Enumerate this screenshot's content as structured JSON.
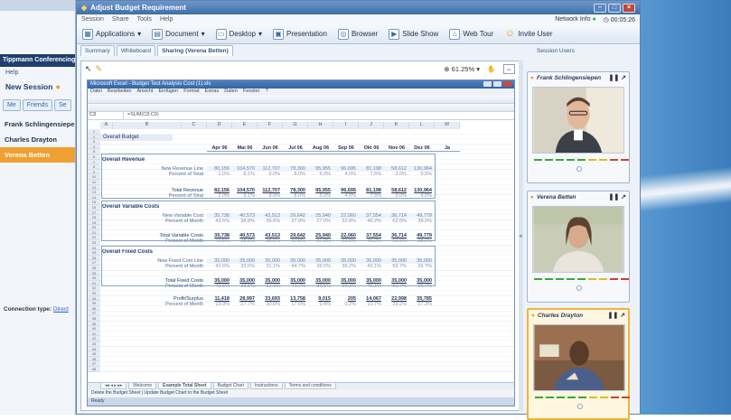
{
  "left_app": {
    "title": "Tippmann Conferencing",
    "help": "Help",
    "new_session": "New Session",
    "tabs": [
      "Me",
      "Friends",
      "Se"
    ],
    "users": [
      {
        "name": "Frank Schlingensiepen",
        "selected": false
      },
      {
        "name": "Charles Drayton",
        "selected": false
      },
      {
        "name": "Verena Betten",
        "selected": true
      }
    ],
    "connection_label": "Connection type:",
    "connection_value": "Direct"
  },
  "window": {
    "title": "Adjust Budget Requirement",
    "menu": [
      "Session",
      "Share",
      "Tools",
      "Help"
    ],
    "network_info": "Network Info",
    "timer": "00:05:26",
    "toolbar": [
      {
        "label": "Applications",
        "icon": "applications-icon",
        "dropdown": true
      },
      {
        "label": "Document",
        "icon": "document-icon",
        "dropdown": true
      },
      {
        "label": "Desktop",
        "icon": "desktop-icon",
        "dropdown": true
      },
      {
        "label": "Presentation",
        "icon": "presentation-icon",
        "dropdown": false
      },
      {
        "label": "Browser",
        "icon": "browser-icon",
        "dropdown": false
      },
      {
        "label": "Slide Show",
        "icon": "slideshow-icon",
        "dropdown": false
      },
      {
        "label": "Web Tour",
        "icon": "webtour-icon",
        "dropdown": false
      },
      {
        "label": "Invite User",
        "icon": "invite-user-icon",
        "dropdown": false
      }
    ],
    "tabs": [
      {
        "label": "Summary",
        "active": false
      },
      {
        "label": "Whiteboard",
        "active": false
      },
      {
        "label": "Sharing (Verena Betten)",
        "active": true
      }
    ],
    "session_users_label": "Session Users",
    "zoom": "61.25%"
  },
  "excel": {
    "title": "Microsoft Excel - Budget Test Analysis Cost (1).xls",
    "menu": [
      "Datei",
      "Bearbeiten",
      "Ansicht",
      "Einfügen",
      "Format",
      "Extras",
      "Daten",
      "Fenster",
      "?"
    ],
    "cell_ref": "C3",
    "formula": "=SUM(C8:C9)",
    "columns": [
      "A",
      "B",
      "C",
      "D",
      "E",
      "F",
      "G",
      "H",
      "I",
      "J",
      "K",
      "L",
      "M"
    ],
    "heading": "Overall Budget",
    "months": [
      "Apr 06",
      "Mai 06",
      "Jun 06",
      "Jul 06",
      "Aug 06",
      "Sep 06",
      "Okt 06",
      "Nov 06",
      "Dez 06",
      "Ja"
    ],
    "rows": [
      {
        "label": "Overall Revenue",
        "kind": "section"
      },
      {
        "label": "New Revenue Line",
        "kind": "input",
        "values": [
          "80,156",
          "104,570",
          "112,707",
          "78,300",
          "95,955",
          "96,695",
          "81,198",
          "58,612",
          "130,964"
        ]
      },
      {
        "label": "Percent of Total",
        "kind": "pct",
        "values": [
          "1.0%",
          "6.1%",
          "9.0%",
          "8.0%",
          "5.0%",
          "4.0%",
          "7.5%",
          "3.0%",
          "9.5%"
        ]
      },
      {
        "label": "Total Revenue",
        "kind": "total",
        "values": [
          "82,156",
          "104,570",
          "112,707",
          "78,300",
          "95,955",
          "96,695",
          "81,198",
          "58,612",
          "130,964"
        ]
      },
      {
        "label": "Percent of Total",
        "kind": "pct",
        "values": [
          "1.0%",
          "6.1%",
          "9.0%",
          "8.0%",
          "5.0%",
          "4.0%",
          "7.5%",
          "3.0%",
          "9.5%"
        ]
      },
      {
        "label": "Overall Variable Costs",
        "kind": "section"
      },
      {
        "label": "New Variable Cost",
        "kind": "input",
        "values": [
          "35,738",
          "40,573",
          "43,513",
          "29,642",
          "25,940",
          "22,060",
          "37,554",
          "36,714",
          "49,779"
        ]
      },
      {
        "label": "Percent of Month",
        "kind": "pct",
        "values": [
          "43.5%",
          "38.8%",
          "38.6%",
          "37.9%",
          "27.0%",
          "22.8%",
          "46.2%",
          "62.6%",
          "38.0%"
        ]
      },
      {
        "label": "Total Variable Costs",
        "kind": "total",
        "values": [
          "35,738",
          "40,573",
          "43,513",
          "29,642",
          "25,940",
          "22,060",
          "37,554",
          "36,714",
          "49,779"
        ]
      },
      {
        "label": "Percent of Month",
        "kind": "pct",
        "values": [
          "43.5%",
          "38.8%",
          "38.6%",
          "37.9%",
          "27.0%",
          "22.8%",
          "46.2%",
          "62.6%",
          "38.0%"
        ]
      },
      {
        "label": "Overall Fixed Costs",
        "kind": "section"
      },
      {
        "label": "New Fixed Cost Line",
        "kind": "input",
        "values": [
          "35,000",
          "35,000",
          "35,000",
          "35,000",
          "35,000",
          "35,000",
          "35,000",
          "35,000",
          "35,000"
        ]
      },
      {
        "label": "Percent of Month",
        "kind": "pct",
        "values": [
          "42.6%",
          "33.5%",
          "31.1%",
          "44.7%",
          "36.5%",
          "36.2%",
          "43.1%",
          "59.7%",
          "26.7%"
        ]
      },
      {
        "label": "Total Fixed Costs",
        "kind": "total",
        "values": [
          "35,000",
          "35,000",
          "35,000",
          "35,000",
          "35,000",
          "35,000",
          "35,000",
          "35,000",
          "35,000"
        ]
      },
      {
        "label": "Percent of Month",
        "kind": "pct",
        "values": [
          "42.6%",
          "33.5%",
          "31.1%",
          "44.7%",
          "36.5%",
          "36.2%",
          "43.1%",
          "59.7%",
          "26.7%"
        ]
      },
      {
        "label": "Profit/Surplus",
        "kind": "total",
        "values": [
          "11,418",
          "28,997",
          "33,693",
          "13,758",
          "9,015",
          "205",
          "14,067",
          "22,998",
          "35,785"
        ]
      },
      {
        "label": "Percent of Month",
        "kind": "pct",
        "values": [
          "13.9%",
          "27.7%",
          "30.0%",
          "17.6%",
          "9.4%",
          "0.2%",
          "10.7%",
          "39.2%",
          "27.3%"
        ]
      }
    ],
    "sheet_tabs": [
      {
        "label": "Welcome",
        "active": false
      },
      {
        "label": "Example Total Sheet",
        "active": true
      },
      {
        "label": "Budget Chart",
        "active": false
      },
      {
        "label": "Instructions",
        "active": false
      },
      {
        "label": "Terms and conditions",
        "active": false
      }
    ],
    "status_text": "Delete the Budget Sheet  |  Update Budget Chart to the Budget Sheet",
    "ready": "Ready"
  },
  "session_users": [
    {
      "name": "Frank Schlingensiepen",
      "active": false
    },
    {
      "name": "Verena Betten",
      "active": false
    },
    {
      "name": "Charles Drayton",
      "active": true
    }
  ],
  "colors": {
    "accent": "#f0a030",
    "title_bar": "#3f6ea8",
    "selection": "#f0b43c"
  }
}
